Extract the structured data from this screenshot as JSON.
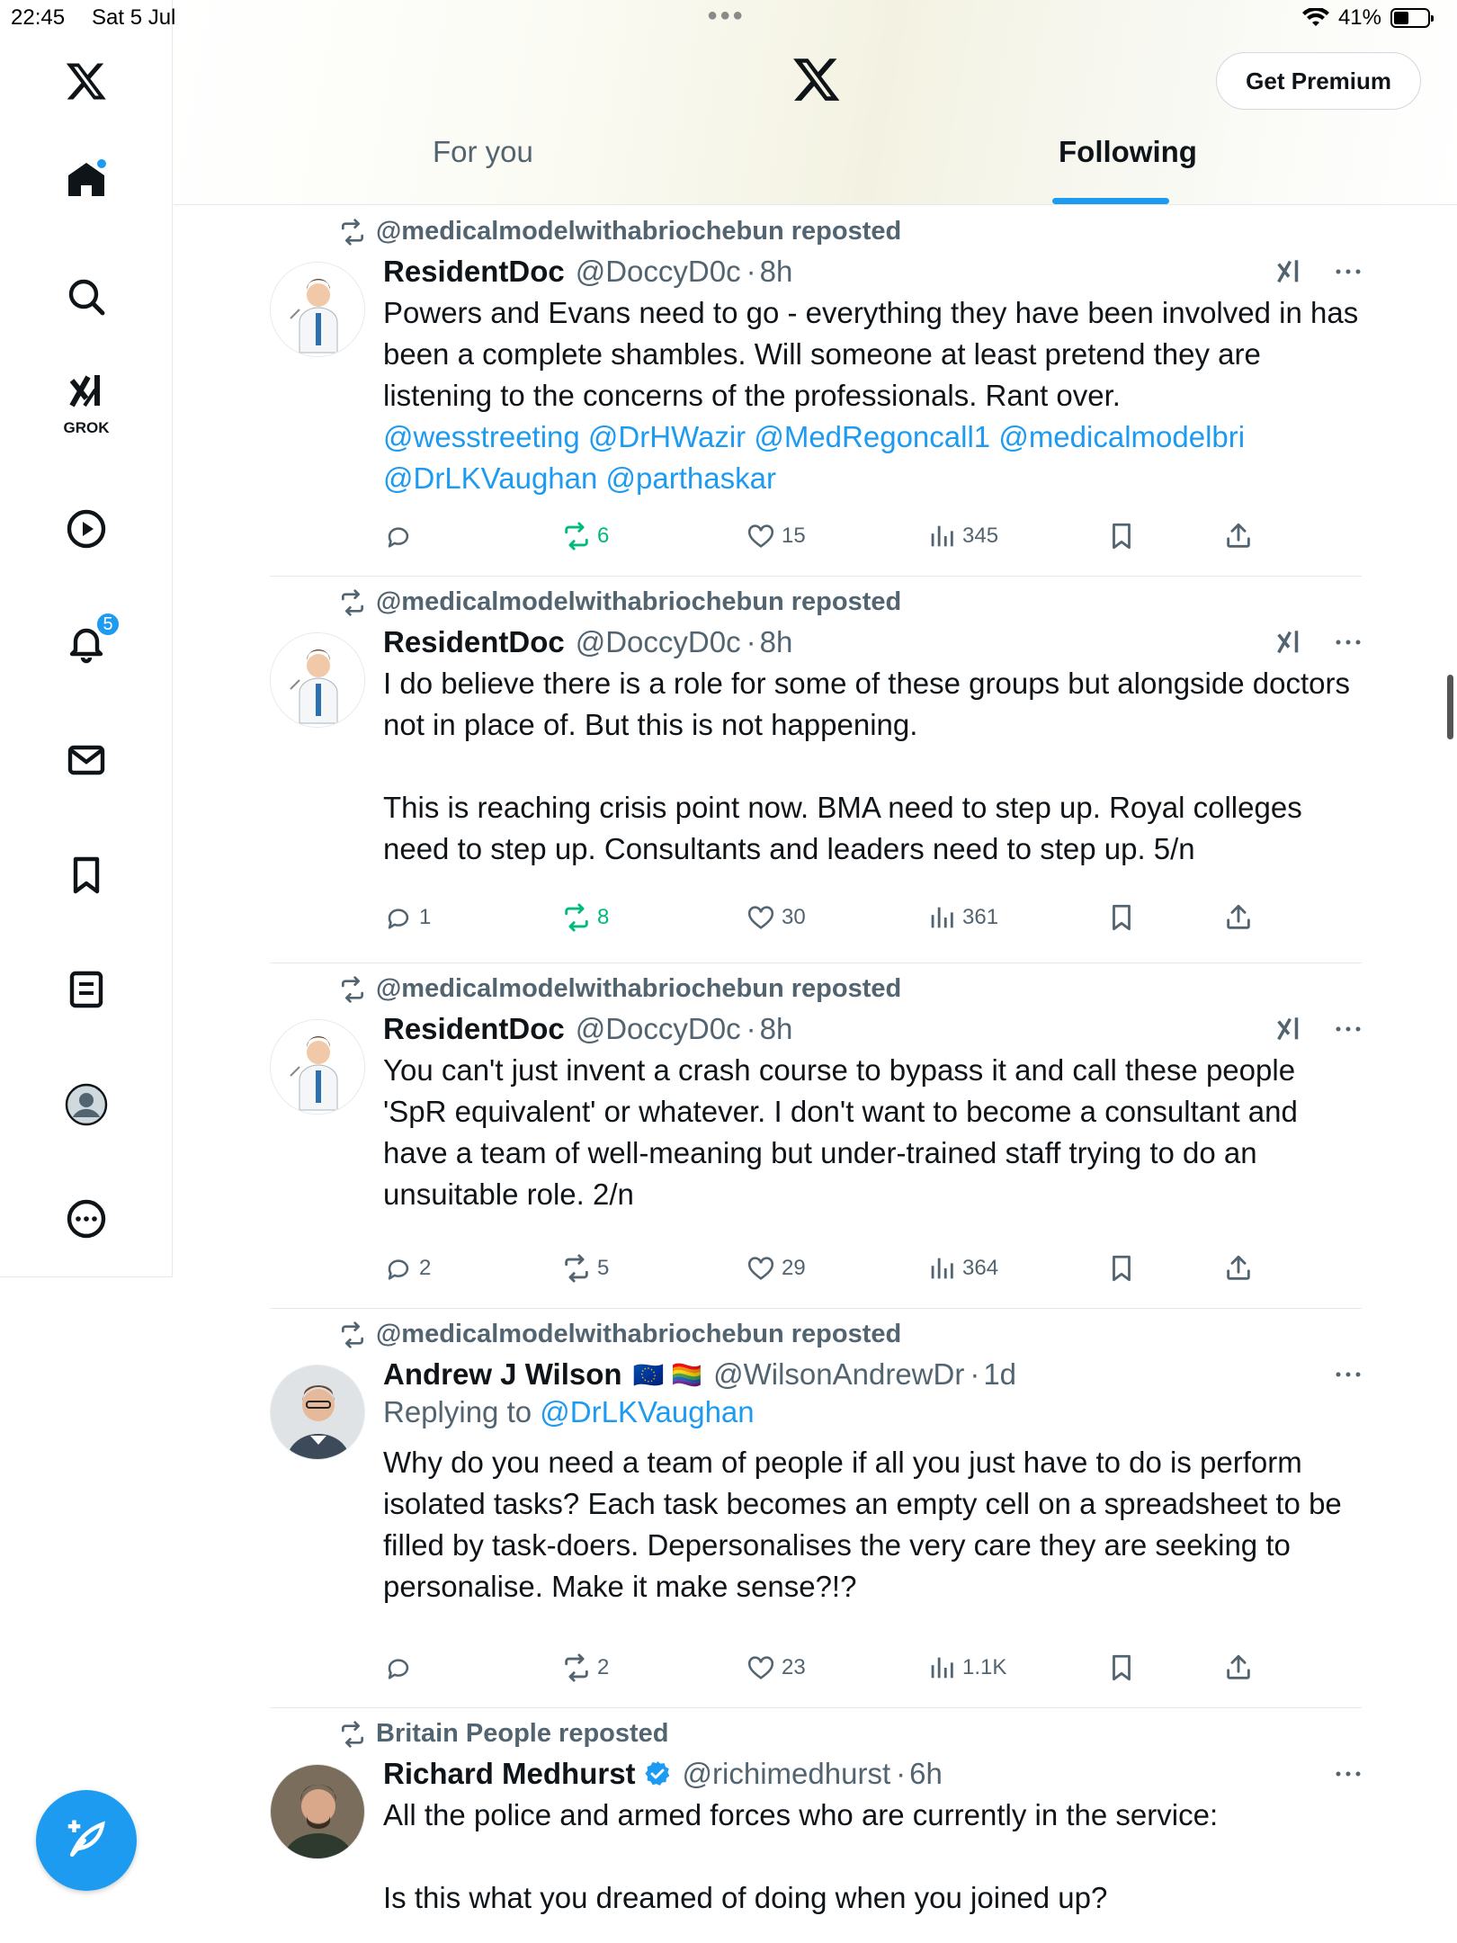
{
  "status_bar": {
    "time": "22:45",
    "date": "Sat 5 Jul",
    "battery": "41%"
  },
  "sidebar": {
    "grok_label": "GROK",
    "notifications_count": "5"
  },
  "header": {
    "premium_label": "Get Premium",
    "tabs": [
      {
        "label": "For you"
      },
      {
        "label": "Following"
      }
    ]
  },
  "tweets": [
    {
      "repost_by": "@medicalmodelwithabriochebun reposted",
      "name": "ResidentDoc",
      "handle": "@DoccyD0c",
      "time": "8h",
      "text_lines": [
        "Powers and Evans need to go - everything they have been involved in has been a complete shambles. Will someone at least pretend they are listening to the concerns of the professionals. Rant over."
      ],
      "mentions_line1": "@wesstreeting @DrHWazir @MedRegoncall1 @medicalmodelbri",
      "mentions_line2": "@DrLKVaughan @parthaskar",
      "replies": "",
      "reposts": "6",
      "likes": "15",
      "views": "345"
    },
    {
      "repost_by": "@medicalmodelwithabriochebun reposted",
      "name": "ResidentDoc",
      "handle": "@DoccyD0c",
      "time": "8h",
      "para1": "I do believe there is a role for some of these groups but alongside doctors not in place of. But this is not happening.",
      "para2": "This is reaching crisis point now. BMA need to step up. Royal colleges need to step up. Consultants and leaders need to step up. 5/n",
      "replies": "1",
      "reposts": "8",
      "likes": "30",
      "views": "361"
    },
    {
      "repost_by": "@medicalmodelwithabriochebun reposted",
      "name": "ResidentDoc",
      "handle": "@DoccyD0c",
      "time": "8h",
      "para1": "You can't just invent a crash course to bypass it and call these people 'SpR equivalent' or whatever. I don't want to become a consultant and have a team of well-meaning but under-trained staff trying to do an unsuitable role. 2/n",
      "replies": "2",
      "reposts": "5",
      "likes": "29",
      "views": "364"
    },
    {
      "repost_by": "@medicalmodelwithabriochebun reposted",
      "name": "Andrew J Wilson",
      "name_flags": "🇪🇺 🏳️‍🌈",
      "handle": "@WilsonAndrewDr",
      "time": "1d",
      "replying_prefix": "Replying to ",
      "replying_to": "@DrLKVaughan",
      "para1": "Why do you need a team of people if all you just have to do is perform isolated tasks? Each task becomes an empty cell on a spreadsheet to be filled by task-doers. Depersonalises the very care they are seeking to personalise. Make it make sense?!?",
      "replies": "",
      "reposts": "2",
      "likes": "23",
      "views": "1.1K"
    },
    {
      "repost_by": "Britain People reposted",
      "name": "Richard Medhurst",
      "handle": "@richimedhurst",
      "time": "6h",
      "para1": "All the police and armed forces who are currently in the service:",
      "para2": "Is this what you dreamed of doing when you joined up?"
    }
  ],
  "separator": "·"
}
